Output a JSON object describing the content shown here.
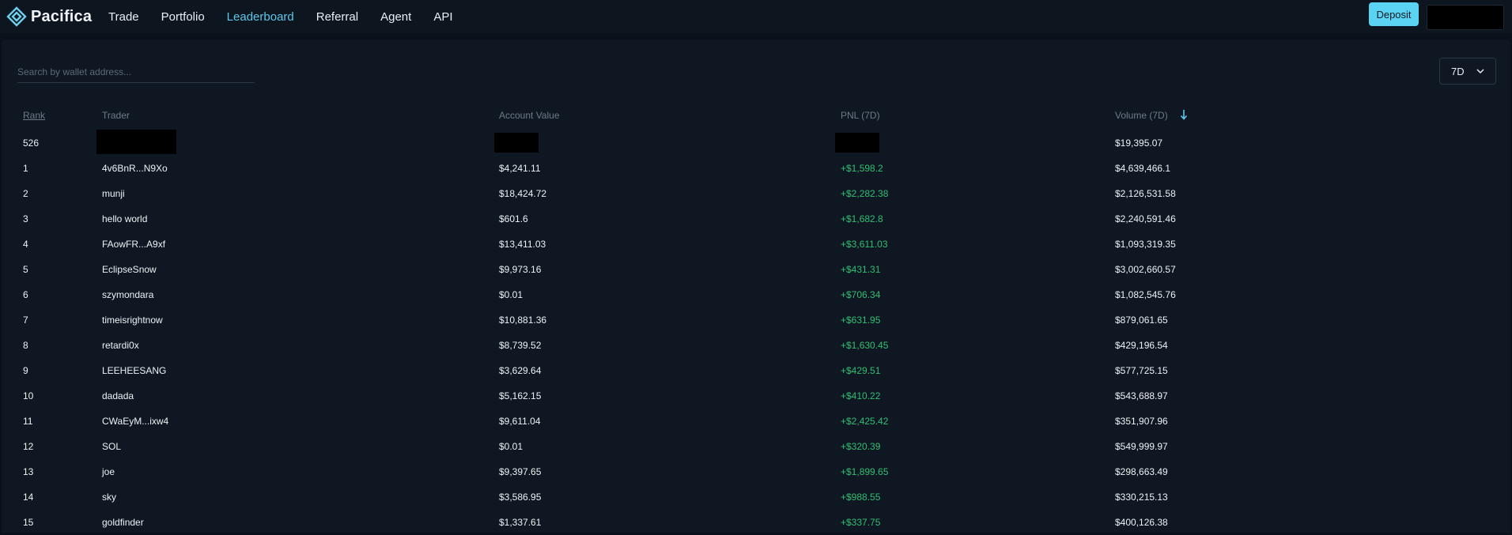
{
  "app": {
    "name": "Pacifica"
  },
  "nav": [
    "Trade",
    "Portfolio",
    "Leaderboard",
    "Referral",
    "Agent",
    "API"
  ],
  "active_nav": "Leaderboard",
  "header": {
    "deposit_label": "Deposit"
  },
  "search": {
    "placeholder": "Search by wallet address..."
  },
  "period": {
    "selected": "7D"
  },
  "columns": {
    "rank": "Rank",
    "trader": "Trader",
    "account_value": "Account Value",
    "pnl": "PNL (7D)",
    "volume": "Volume (7D)"
  },
  "my_row": {
    "rank": "526",
    "volume": "$19,395.07"
  },
  "rows": [
    {
      "rank": "1",
      "trader": "4v6BnR...N9Xo",
      "account_value": "$4,241.11",
      "pnl": "+$1,598.2",
      "volume": "$4,639,466.1"
    },
    {
      "rank": "2",
      "trader": "munji",
      "account_value": "$18,424.72",
      "pnl": "+$2,282.38",
      "volume": "$2,126,531.58"
    },
    {
      "rank": "3",
      "trader": "hello world",
      "account_value": "$601.6",
      "pnl": "+$1,682.8",
      "volume": "$2,240,591.46"
    },
    {
      "rank": "4",
      "trader": "FAowFR...A9xf",
      "account_value": "$13,411.03",
      "pnl": "+$3,611.03",
      "volume": "$1,093,319.35"
    },
    {
      "rank": "5",
      "trader": "EclipseSnow",
      "account_value": "$9,973.16",
      "pnl": "+$431.31",
      "volume": "$3,002,660.57"
    },
    {
      "rank": "6",
      "trader": "szymondara",
      "account_value": "$0.01",
      "pnl": "+$706.34",
      "volume": "$1,082,545.76"
    },
    {
      "rank": "7",
      "trader": "timeisrightnow",
      "account_value": "$10,881.36",
      "pnl": "+$631.95",
      "volume": "$879,061.65"
    },
    {
      "rank": "8",
      "trader": "retardi0x",
      "account_value": "$8,739.52",
      "pnl": "+$1,630.45",
      "volume": "$429,196.54"
    },
    {
      "rank": "9",
      "trader": "LEEHEESANG",
      "account_value": "$3,629.64",
      "pnl": "+$429.51",
      "volume": "$577,725.15"
    },
    {
      "rank": "10",
      "trader": "dadada",
      "account_value": "$5,162.15",
      "pnl": "+$410.22",
      "volume": "$543,688.97"
    },
    {
      "rank": "11",
      "trader": "CWaEyM...ixw4",
      "account_value": "$9,611.04",
      "pnl": "+$2,425.42",
      "volume": "$351,907.96"
    },
    {
      "rank": "12",
      "trader": "SOL",
      "account_value": "$0.01",
      "pnl": "+$320.39",
      "volume": "$549,999.97"
    },
    {
      "rank": "13",
      "trader": "joe",
      "account_value": "$9,397.65",
      "pnl": "+$1,899.65",
      "volume": "$298,663.49"
    },
    {
      "rank": "14",
      "trader": "sky",
      "account_value": "$3,586.95",
      "pnl": "+$988.55",
      "volume": "$330,215.13"
    },
    {
      "rank": "15",
      "trader": "goldfinder",
      "account_value": "$1,337.61",
      "pnl": "+$337.75",
      "volume": "$400,126.38"
    }
  ],
  "colors": {
    "accent": "#5ec7ea",
    "deposit": "#5bd3f2",
    "positive": "#2fbf72",
    "background": "#0b111a",
    "panel": "#0f1722"
  },
  "icons": [
    "pacifica-logo-icon",
    "chevron-down-icon",
    "sort-desc-arrow-icon"
  ]
}
